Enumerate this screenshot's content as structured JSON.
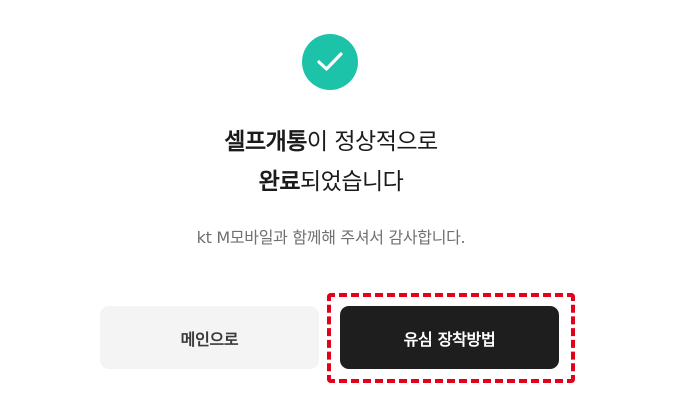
{
  "status_icon": "check-circle-icon",
  "headline": {
    "line1_bold": "셀프개통",
    "line1_rest": "이 정상적으로",
    "line2_bold": "완료",
    "line2_rest": "되었습니다"
  },
  "subtitle": "kt M모바일과 함께해 주셔서 감사합니다.",
  "buttons": {
    "main_label": "메인으로",
    "sim_guide_label": "유심 장착방법"
  },
  "colors": {
    "accent": "#1cc3a8",
    "primary_button": "#1e1e1e",
    "secondary_button": "#f4f4f4",
    "highlight": "#e4001b"
  }
}
